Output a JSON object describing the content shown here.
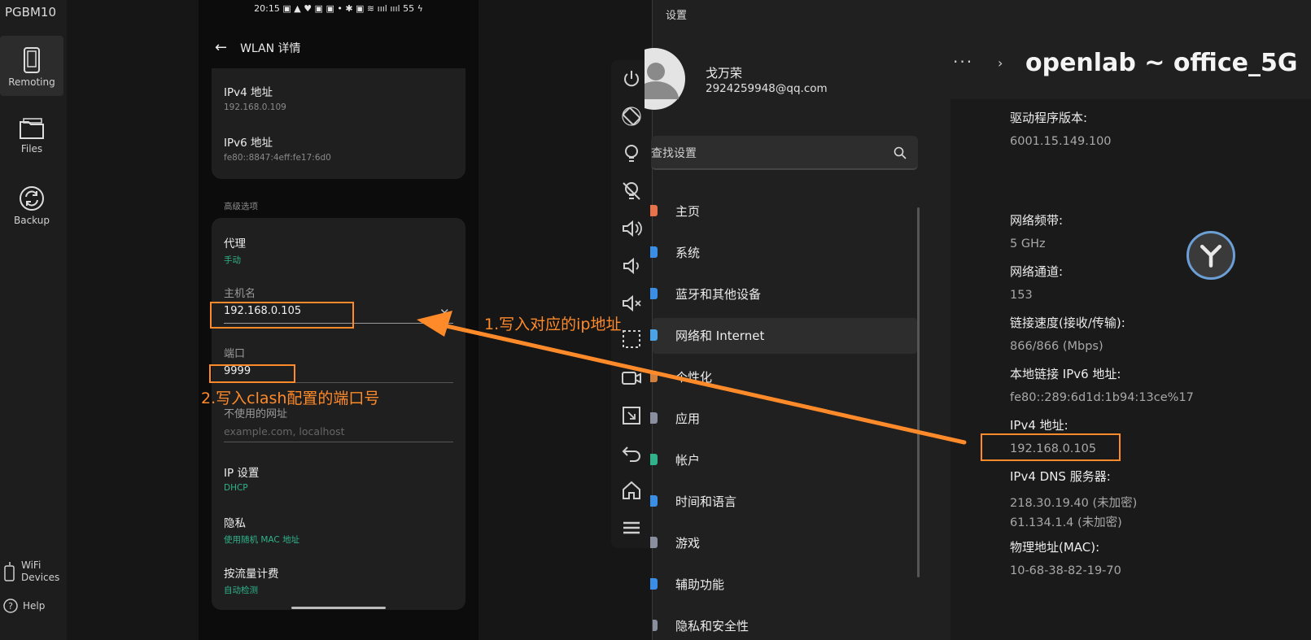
{
  "rail": {
    "title": "PGBM10",
    "items": [
      {
        "label": "Remoting",
        "icon": "phone-icon"
      },
      {
        "label": "Files",
        "icon": "folder-icon"
      },
      {
        "label": "Backup",
        "icon": "sync-icon"
      }
    ],
    "wifi_devices": "WiFi\nDevices",
    "help": "Help"
  },
  "phone": {
    "statusbar": "20:15 ▣ ▲ ♥ ▣ ▣ •   ✱ ▣ ≋ ıııl ıııl 55 ϟ",
    "header_title": "WLAN 详情",
    "ipv4_label": "IPv4 地址",
    "ipv4_value": "192.168.0.109",
    "ipv6_label": "IPv6 地址",
    "ipv6_value": "fe80::8847:4eff:fe17:6d0",
    "advanced_title": "高级选项",
    "proxy_label": "代理",
    "proxy_value": "手动",
    "hostname_label": "主机名",
    "hostname_value": "192.168.0.105",
    "port_label": "端口",
    "port_value": "9999",
    "bypass_label": "不使用的网址",
    "bypass_placeholder": "example.com, localhost",
    "ip_settings_label": "IP 设置",
    "ip_settings_value": "DHCP",
    "privacy_label": "隐私",
    "privacy_value": "使用随机 MAC 地址",
    "metered_label": "按流量计费",
    "metered_value": "自动检测"
  },
  "toolbar": {
    "icons": [
      "power-icon",
      "rotate-icon",
      "bulb-icon",
      "bulb-off-icon",
      "volume-up-icon",
      "volume-down-icon",
      "mute-icon",
      "screenshot-icon",
      "record-icon",
      "crop-icon",
      "back-icon",
      "home-icon",
      "menu-icon"
    ]
  },
  "settings": {
    "title": "设置",
    "user_name": "戈万荣",
    "user_email": "2924259948@qq.com",
    "search_placeholder": "查找设置",
    "nav": [
      {
        "label": "主页",
        "color": "#e8734a"
      },
      {
        "label": "系统",
        "color": "#3a8ee6"
      },
      {
        "label": "蓝牙和其他设备",
        "color": "#3a8ee6"
      },
      {
        "label": "网络和 Internet",
        "color": "#4aa3e6"
      },
      {
        "label": "个性化",
        "color": "#d0803c"
      },
      {
        "label": "应用",
        "color": "#8a8fa0"
      },
      {
        "label": "帐户",
        "color": "#2fb38a"
      },
      {
        "label": "时间和语言",
        "color": "#3a8ee6"
      },
      {
        "label": "游戏",
        "color": "#8a8fa0"
      },
      {
        "label": "辅助功能",
        "color": "#3a8ee6"
      },
      {
        "label": "隐私和安全性",
        "color": "#8a8fa0"
      }
    ]
  },
  "detail": {
    "breadcrumb_dots": "···",
    "breadcrumb_chevron": "›",
    "breadcrumb_title": "openlab ~ office_5G",
    "fields": [
      {
        "label": "驱动程序版本:",
        "value": "6001.15.149.100"
      },
      {
        "label": "网络频带:",
        "value": "5 GHz"
      },
      {
        "label": "网络通道:",
        "value": "153"
      },
      {
        "label": "链接速度(接收/传输):",
        "value": "866/866 (Mbps)"
      },
      {
        "label": "本地链接 IPv6 地址:",
        "value": "fe80::289:6d1d:1b94:13ce%17"
      },
      {
        "label": "IPv4 地址:",
        "value": "192.168.0.105"
      },
      {
        "label": "IPv4 DNS 服务器:",
        "value": "218.30.19.40 (未加密)"
      },
      {
        "label": "",
        "value": "61.134.1.4 (未加密)"
      },
      {
        "label": "物理地址(MAC):",
        "value": "10-68-38-82-19-70"
      }
    ]
  },
  "annotations": {
    "note1": "1.写入对应的ip地址",
    "note2": "2.写入clash配置的端口号",
    "color": "#ff8a2a"
  }
}
